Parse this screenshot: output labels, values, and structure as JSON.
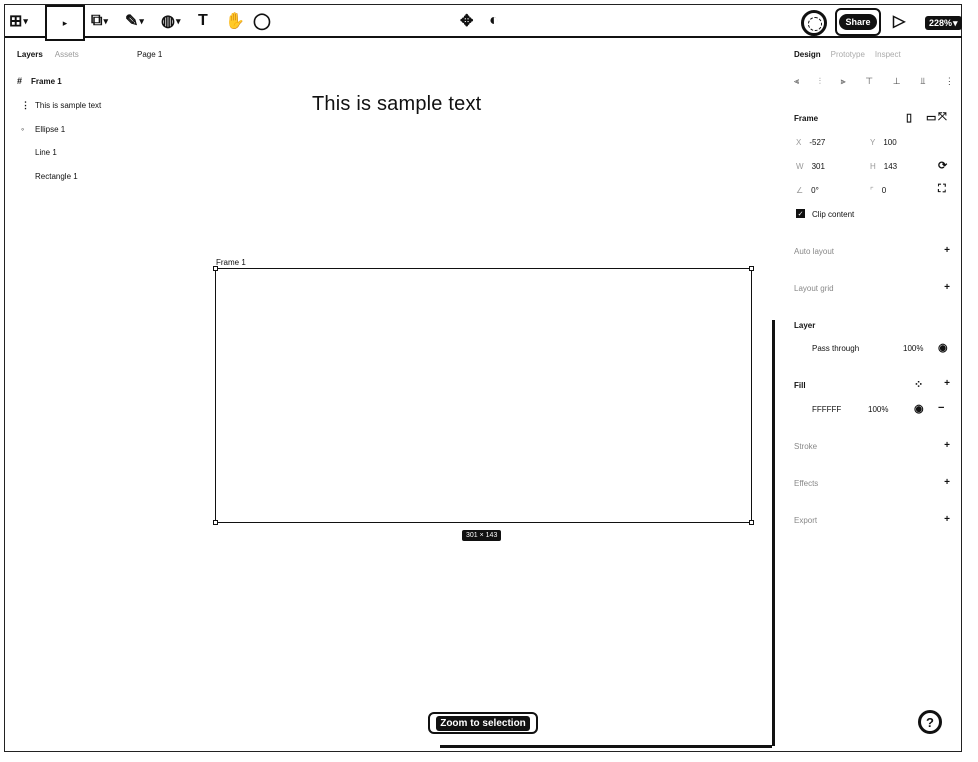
{
  "toolbar": {
    "tools": [
      {
        "name": "main-menu",
        "glyph": "⊞"
      },
      {
        "name": "move",
        "glyph": "▸"
      },
      {
        "name": "frame",
        "glyph": "⧉"
      },
      {
        "name": "pen",
        "glyph": "✎"
      },
      {
        "name": "shape",
        "glyph": "◍"
      },
      {
        "name": "text",
        "glyph": "T"
      },
      {
        "name": "hand",
        "glyph": "✋"
      },
      {
        "name": "comment",
        "glyph": "◯"
      }
    ],
    "center_icons": [
      {
        "name": "component",
        "glyph": "✥"
      },
      {
        "name": "theme",
        "glyph": "◐"
      }
    ],
    "share_label": "Share",
    "play_glyph": "▷",
    "zoom_level": "228%"
  },
  "left_panel": {
    "tabs": [
      "Layers",
      "Assets"
    ],
    "page": "Page 1",
    "layers": [
      {
        "icon": "#",
        "label": "Frame 1",
        "bold": true
      },
      {
        "icon": "⋮",
        "label": "This is sample text"
      },
      {
        "icon": "◦",
        "label": "Ellipse 1"
      },
      {
        "icon": "",
        "label": "Line 1"
      },
      {
        "icon": "",
        "label": "Rectangle 1"
      }
    ]
  },
  "canvas": {
    "text_element": "This is sample text",
    "frame_label": "Frame 1",
    "dimensions": "301 × 143",
    "zoom_to_selection": "Zoom to selection"
  },
  "right_panel": {
    "tabs": [
      "Design",
      "Prototype",
      "Inspect"
    ],
    "frame_title": "Frame",
    "x_label": "X",
    "x_value": "-527",
    "y_label": "Y",
    "y_value": "100",
    "w_label": "W",
    "w_value": "301",
    "h_label": "H",
    "h_value": "143",
    "r_label": "∠",
    "r_value": "0°",
    "radius_label": "⌜",
    "radius_value": "0",
    "clip_content": "Clip content",
    "auto_layout": "Auto layout",
    "layout_grid": "Layout grid",
    "layer_title": "Layer",
    "blend_mode": "Pass through",
    "layer_opacity": "100%",
    "fill_title": "Fill",
    "fill_hex": "FFFFFF",
    "fill_opacity": "100%",
    "stroke": "Stroke",
    "effects": "Effects",
    "export": "Export"
  }
}
